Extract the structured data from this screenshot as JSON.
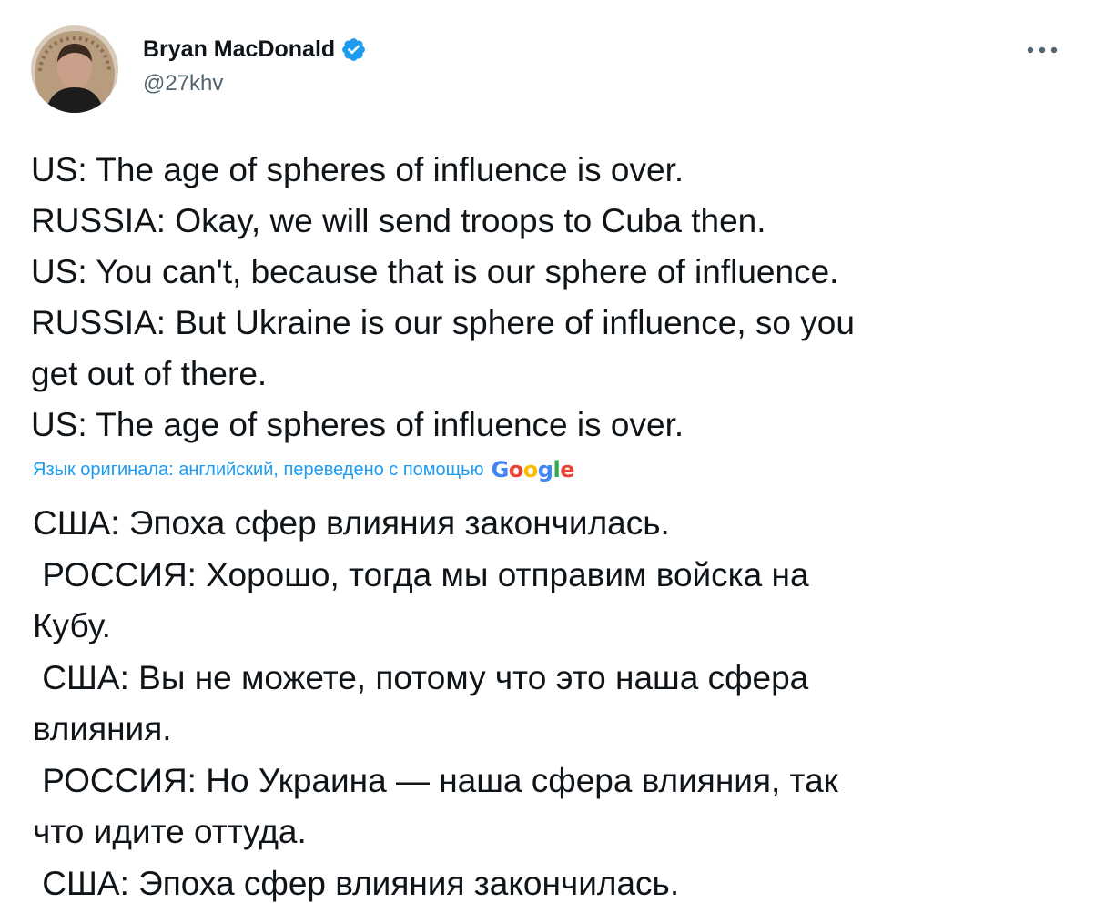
{
  "author": {
    "display_name": "Bryan MacDonald",
    "handle": "@27khv",
    "verified": true,
    "avatar_icon": "profile-photo"
  },
  "menu_icon": "more-options-icon",
  "tweet": {
    "lines": [
      "US: The age of spheres of influence is over.",
      "RUSSIA: Okay, we will send troops to Cuba then.",
      "US: You can't, because that is our sphere of influence.",
      "RUSSIA: But Ukraine is our sphere of influence, so you",
      "get out of there.",
      "US: The age of spheres of influence is over."
    ]
  },
  "translation": {
    "label": "Язык оригинала: английский, переведено с помощью",
    "provider": "Google",
    "provider_letter_colors": [
      "#4285f4",
      "#ea4335",
      "#fbbc05",
      "#4285f4",
      "#34a853",
      "#ea4335"
    ],
    "lines": [
      "США: Эпоха сфер влияния закончилась.",
      " РОССИЯ: Хорошо, тогда мы отправим войска на",
      "Кубу.",
      " США: Вы не можете, потому что это наша сфера",
      "влияния.",
      " РОССИЯ: Но Украина — наша сфера влияния, так",
      "что идите оттуда.",
      " США: Эпоха сфер влияния закончилась."
    ]
  },
  "colors": {
    "text": "#0f1419",
    "secondary": "#536471",
    "accent": "#1d9bf0"
  }
}
